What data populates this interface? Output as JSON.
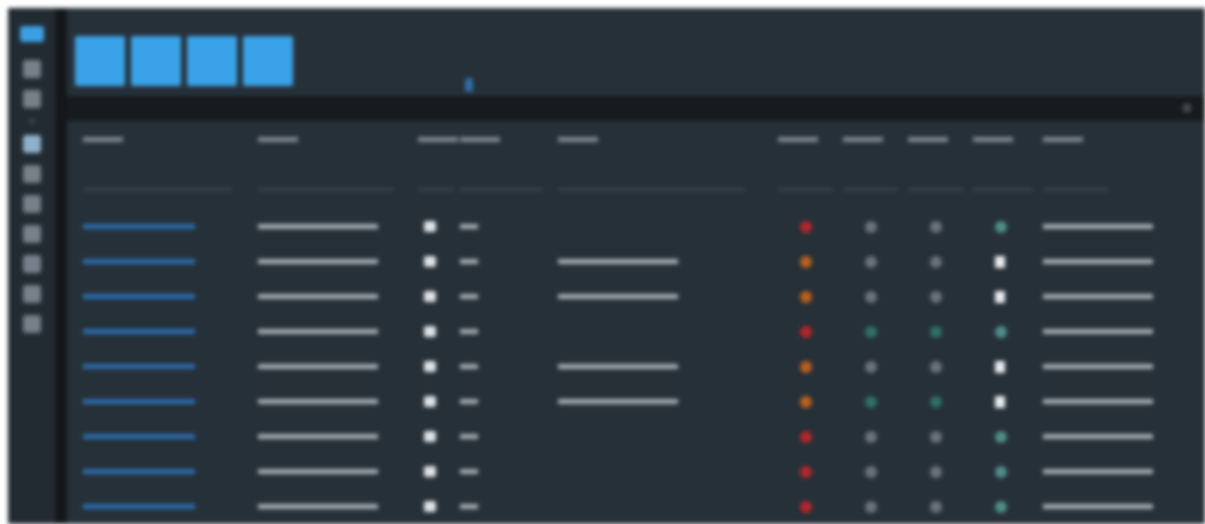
{
  "sidebar": {
    "items": [
      {
        "kind": "logo"
      },
      {
        "kind": "icon",
        "selected": false
      },
      {
        "kind": "icon",
        "selected": false
      },
      {
        "kind": "dot"
      },
      {
        "kind": "icon",
        "selected": true
      },
      {
        "kind": "icon",
        "selected": false
      },
      {
        "kind": "icon",
        "selected": false
      },
      {
        "kind": "icon",
        "selected": false
      },
      {
        "kind": "icon",
        "selected": false
      },
      {
        "kind": "icon",
        "selected": false
      },
      {
        "kind": "icon",
        "selected": false
      }
    ]
  },
  "toolbar": {
    "tiles": [
      {
        "kind": "tile"
      },
      {
        "kind": "tile"
      },
      {
        "kind": "tile"
      },
      {
        "kind": "tile"
      }
    ]
  },
  "table": {
    "columns": [
      {
        "kind": "text"
      },
      {
        "kind": "text"
      },
      {
        "kind": "text"
      },
      {
        "kind": "text"
      },
      {
        "kind": "text"
      },
      {
        "kind": "select"
      },
      {
        "kind": "select"
      },
      {
        "kind": "select"
      },
      {
        "kind": "select"
      },
      {
        "kind": "date"
      }
    ],
    "rows": [
      {
        "cells": [
          {
            "kind": "link"
          },
          {
            "kind": "text"
          },
          {
            "kind": "square"
          },
          {
            "kind": "short"
          },
          {
            "kind": "empty"
          },
          {
            "kind": "dot",
            "color": "#b3262c"
          },
          {
            "kind": "dot",
            "color": "#6b747c"
          },
          {
            "kind": "dot",
            "color": "#6b747c"
          },
          {
            "kind": "dot",
            "color": "#4f8f8a"
          },
          {
            "kind": "text"
          }
        ]
      },
      {
        "cells": [
          {
            "kind": "link"
          },
          {
            "kind": "text"
          },
          {
            "kind": "square"
          },
          {
            "kind": "short"
          },
          {
            "kind": "text"
          },
          {
            "kind": "dot",
            "color": "#b8601f"
          },
          {
            "kind": "dot",
            "color": "#6b747c"
          },
          {
            "kind": "dot",
            "color": "#6b747c"
          },
          {
            "kind": "file"
          },
          {
            "kind": "text"
          }
        ]
      },
      {
        "cells": [
          {
            "kind": "link"
          },
          {
            "kind": "text"
          },
          {
            "kind": "square"
          },
          {
            "kind": "short"
          },
          {
            "kind": "text"
          },
          {
            "kind": "dot",
            "color": "#b8601f"
          },
          {
            "kind": "dot",
            "color": "#6b747c"
          },
          {
            "kind": "dot",
            "color": "#6b747c"
          },
          {
            "kind": "file"
          },
          {
            "kind": "text"
          }
        ]
      },
      {
        "cells": [
          {
            "kind": "link"
          },
          {
            "kind": "text"
          },
          {
            "kind": "square"
          },
          {
            "kind": "short"
          },
          {
            "kind": "empty"
          },
          {
            "kind": "dot",
            "color": "#b3262c"
          },
          {
            "kind": "dot",
            "color": "#2f6f6a"
          },
          {
            "kind": "dot",
            "color": "#2f6f6a"
          },
          {
            "kind": "dot",
            "color": "#4f8f8a"
          },
          {
            "kind": "text"
          }
        ]
      },
      {
        "cells": [
          {
            "kind": "link"
          },
          {
            "kind": "text"
          },
          {
            "kind": "square"
          },
          {
            "kind": "short"
          },
          {
            "kind": "text"
          },
          {
            "kind": "dot",
            "color": "#b8601f"
          },
          {
            "kind": "dot",
            "color": "#6b747c"
          },
          {
            "kind": "dot",
            "color": "#6b747c"
          },
          {
            "kind": "file"
          },
          {
            "kind": "text"
          }
        ]
      },
      {
        "cells": [
          {
            "kind": "link"
          },
          {
            "kind": "text"
          },
          {
            "kind": "square"
          },
          {
            "kind": "short"
          },
          {
            "kind": "text"
          },
          {
            "kind": "dot",
            "color": "#b8601f"
          },
          {
            "kind": "dot",
            "color": "#2f6f6a"
          },
          {
            "kind": "dot",
            "color": "#2f6f6a"
          },
          {
            "kind": "file"
          },
          {
            "kind": "text"
          }
        ]
      },
      {
        "cells": [
          {
            "kind": "link"
          },
          {
            "kind": "text"
          },
          {
            "kind": "square"
          },
          {
            "kind": "short"
          },
          {
            "kind": "empty"
          },
          {
            "kind": "dot",
            "color": "#b3262c"
          },
          {
            "kind": "dot",
            "color": "#6b747c"
          },
          {
            "kind": "dot",
            "color": "#6b747c"
          },
          {
            "kind": "dot",
            "color": "#4f8f8a"
          },
          {
            "kind": "text"
          }
        ]
      },
      {
        "cells": [
          {
            "kind": "link"
          },
          {
            "kind": "text"
          },
          {
            "kind": "square"
          },
          {
            "kind": "short"
          },
          {
            "kind": "empty"
          },
          {
            "kind": "dot",
            "color": "#b3262c"
          },
          {
            "kind": "dot",
            "color": "#6b747c"
          },
          {
            "kind": "dot",
            "color": "#6b747c"
          },
          {
            "kind": "dot",
            "color": "#4f8f8a"
          },
          {
            "kind": "text"
          }
        ]
      },
      {
        "cells": [
          {
            "kind": "link"
          },
          {
            "kind": "text"
          },
          {
            "kind": "square"
          },
          {
            "kind": "short"
          },
          {
            "kind": "empty"
          },
          {
            "kind": "dot",
            "color": "#b3262c"
          },
          {
            "kind": "dot",
            "color": "#6b747c"
          },
          {
            "kind": "dot",
            "color": "#6b747c"
          },
          {
            "kind": "dot",
            "color": "#4f8f8a"
          },
          {
            "kind": "text"
          }
        ]
      }
    ]
  }
}
